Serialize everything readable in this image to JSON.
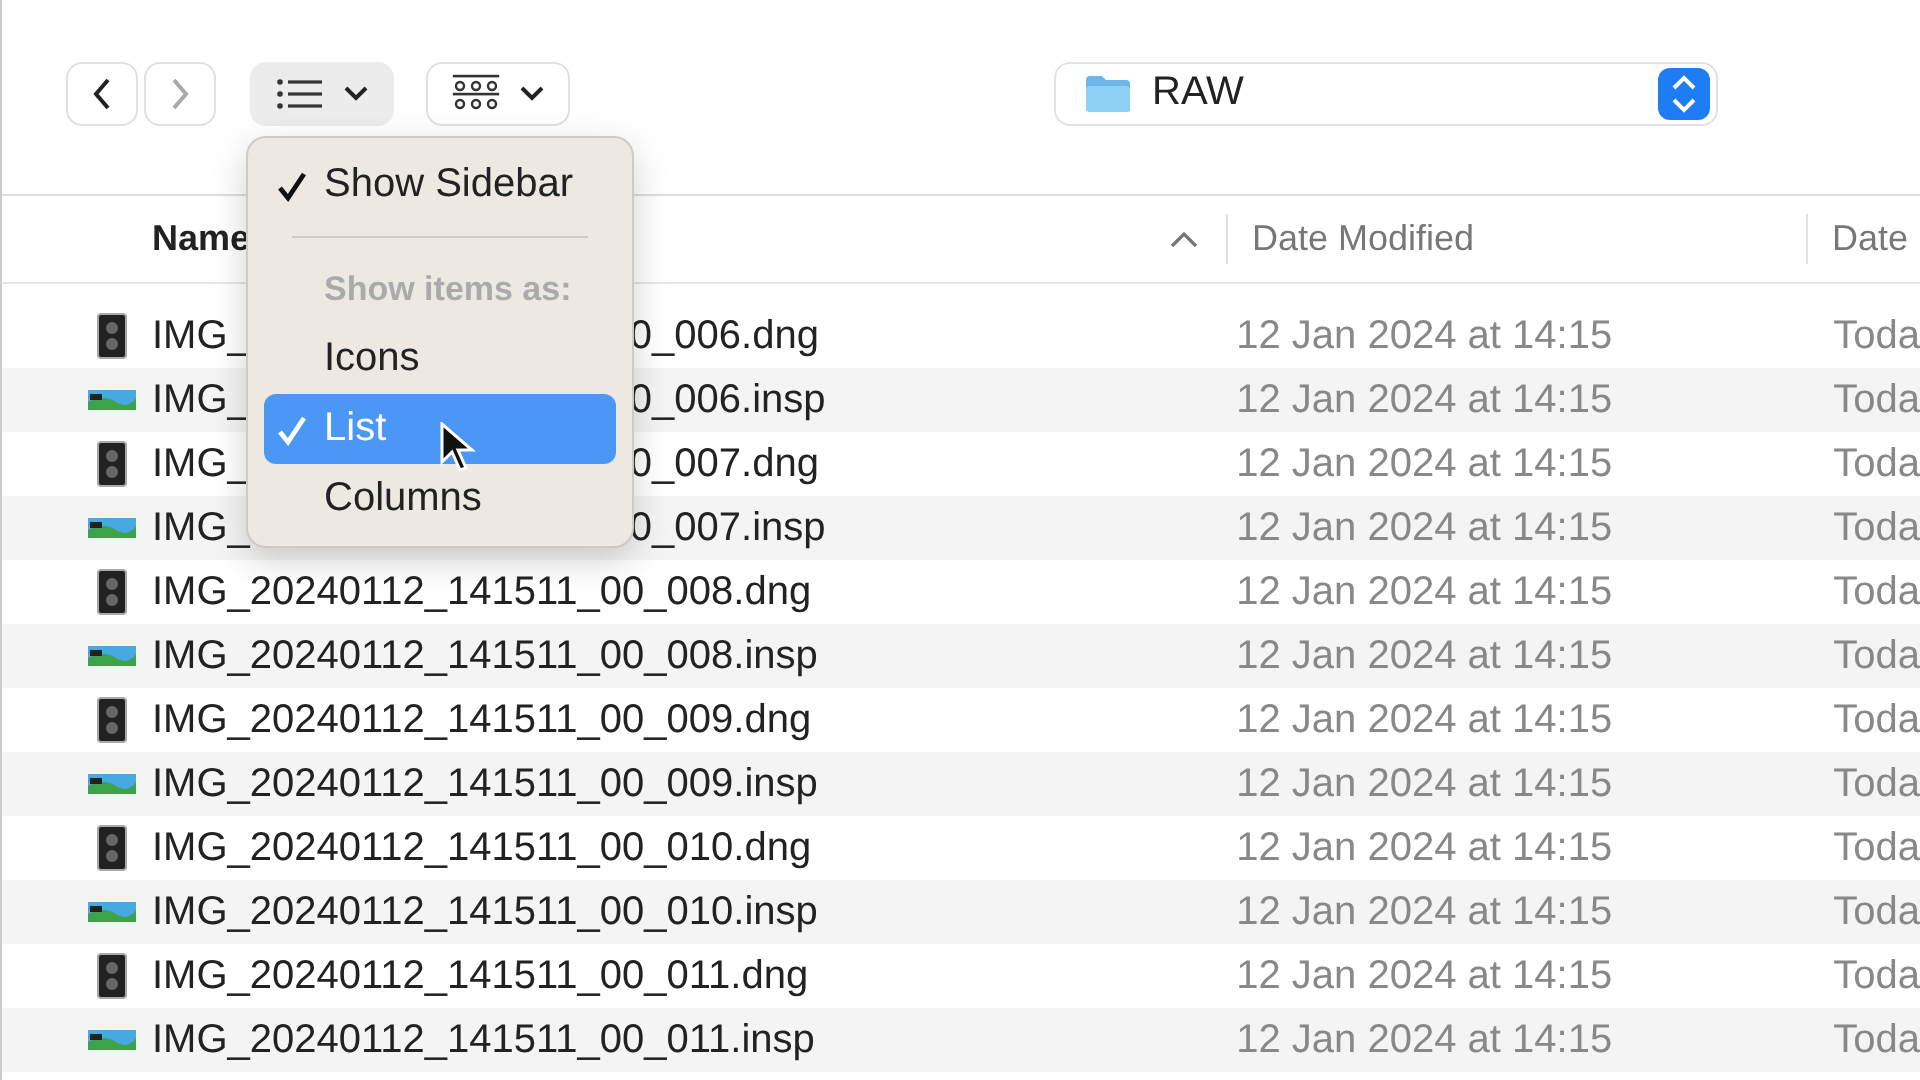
{
  "toolbar": {
    "location": "RAW"
  },
  "columns": [
    {
      "label": "Name",
      "sorted": true
    },
    {
      "label": "Date Modified",
      "sorted": false
    },
    {
      "label": "Date",
      "sorted": false
    }
  ],
  "rows": [
    {
      "kind": "split",
      "name_left": "IMG_",
      "name_right": "0_006.dng",
      "date": "12 Jan 2024 at 14:15",
      "column_3": "Toda"
    },
    {
      "kind": "split",
      "name_left": "IMG_",
      "name_right": "0_006.insp",
      "date": "12 Jan 2024 at 14:15",
      "column_3": "Toda"
    },
    {
      "kind": "split",
      "name_left": "IMG_",
      "name_right": "0_007.dng",
      "date": "12 Jan 2024 at 14:15",
      "column_3": "Toda"
    },
    {
      "kind": "split",
      "name_left": "IMG_",
      "name_right": "0_007.insp",
      "date": "12 Jan 2024 at 14:15",
      "column_3": "Toda"
    },
    {
      "kind": "full",
      "name": "IMG_20240112_141511_00_008.dng",
      "date": "12 Jan 2024 at 14:15",
      "column_3": "Toda"
    },
    {
      "kind": "full",
      "name": "IMG_20240112_141511_00_008.insp",
      "date": "12 Jan 2024 at 14:15",
      "column_3": "Toda"
    },
    {
      "kind": "full",
      "name": "IMG_20240112_141511_00_009.dng",
      "date": "12 Jan 2024 at 14:15",
      "column_3": "Toda"
    },
    {
      "kind": "full",
      "name": "IMG_20240112_141511_00_009.insp",
      "date": "12 Jan 2024 at 14:15",
      "column_3": "Toda"
    },
    {
      "kind": "full",
      "name": "IMG_20240112_141511_00_010.dng",
      "date": "12 Jan 2024 at 14:15",
      "column_3": "Toda"
    },
    {
      "kind": "full",
      "name": "IMG_20240112_141511_00_010.insp",
      "date": "12 Jan 2024 at 14:15",
      "column_3": "Toda"
    },
    {
      "kind": "full",
      "name": "IMG_20240112_141511_00_011.dng",
      "date": "12 Jan 2024 at 14:15",
      "column_3": "Toda"
    },
    {
      "kind": "full",
      "name": "IMG_20240112_141511_00_011.insp",
      "date": "12 Jan 2024 at 14:15",
      "column_3": "Toda"
    }
  ],
  "menu": {
    "items": [
      {
        "kind": "toggle",
        "label": "Show Sidebar",
        "checked": true,
        "selected": false
      },
      {
        "kind": "separator"
      },
      {
        "kind": "heading",
        "label": "Show items as:"
      },
      {
        "kind": "option",
        "label": "Icons",
        "checked": false,
        "selected": false
      },
      {
        "kind": "option",
        "label": "List",
        "checked": true,
        "selected": true
      },
      {
        "kind": "option",
        "label": "Columns",
        "checked": false,
        "selected": false
      }
    ]
  }
}
